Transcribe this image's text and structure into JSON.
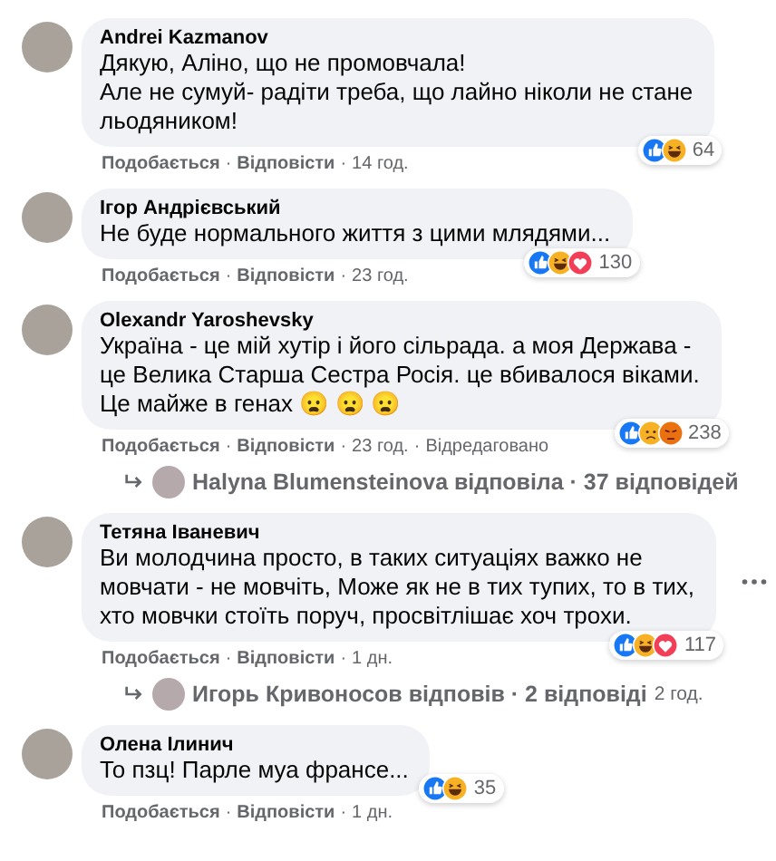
{
  "comments": [
    {
      "author": "Andrei Kazmanov",
      "text": "Дякую, Аліно, що не промовчала!\nАле не сумуй- радіти треба, що лайно ніколи не стане\nльодяником!",
      "reactions": [
        {
          "kind": "like"
        },
        {
          "kind": "haha"
        }
      ],
      "reaction_count": "64",
      "actions": [
        {
          "kind": "link",
          "text": "Подобається"
        },
        {
          "kind": "separator",
          "text": "·"
        },
        {
          "kind": "link",
          "text": "Відповісти"
        },
        {
          "kind": "separator",
          "text": "·"
        },
        {
          "kind": "time",
          "text": "14 год."
        }
      ],
      "show_menu": false
    },
    {
      "author": "Ігор Андрієвський",
      "text": "Не буде нормального життя з цими млядями...",
      "reactions": [
        {
          "kind": "like"
        },
        {
          "kind": "haha"
        },
        {
          "kind": "love"
        }
      ],
      "reaction_count": "130",
      "actions": [
        {
          "kind": "link",
          "text": "Подобається"
        },
        {
          "kind": "separator",
          "text": "·"
        },
        {
          "kind": "link",
          "text": "Відповісти"
        },
        {
          "kind": "separator",
          "text": "·"
        },
        {
          "kind": "time",
          "text": "23 год."
        }
      ],
      "show_menu": false
    },
    {
      "author": "Olexandr Yaroshevsky",
      "text": "Україна - це мій хутір і його сільрада. а моя Держава -\nце Велика Старша Сестра Росія. це вбивалося віками.\nЦе майже в генах 😦 😦 😦",
      "reactions": [
        {
          "kind": "like"
        },
        {
          "kind": "sad"
        },
        {
          "kind": "angry"
        }
      ],
      "reaction_count": "238",
      "actions": [
        {
          "kind": "link",
          "text": "Подобається"
        },
        {
          "kind": "separator",
          "text": "·"
        },
        {
          "kind": "link",
          "text": "Відповісти"
        },
        {
          "kind": "separator",
          "text": "·"
        },
        {
          "kind": "time",
          "text": "23 год."
        },
        {
          "kind": "separator",
          "text": "·"
        },
        {
          "kind": "time",
          "text": "Відредаговано"
        }
      ],
      "show_menu": false,
      "replies": {
        "text": "Halyna Blumensteinova відповіла · 37 відповідей"
      }
    },
    {
      "author": "Тетяна Іваневич",
      "text": "Ви молодчина просто, в таких ситуаціях важко не\nмовчати - не мовчіть, Може як не в тих тупих, то в тих,\nхто мовчки стоїть поруч, просвітлішає хоч трохи.",
      "reactions": [
        {
          "kind": "like"
        },
        {
          "kind": "haha"
        },
        {
          "kind": "love"
        }
      ],
      "reaction_count": "117",
      "actions": [
        {
          "kind": "link",
          "text": "Подобається"
        },
        {
          "kind": "separator",
          "text": "·"
        },
        {
          "kind": "link",
          "text": "Відповісти"
        },
        {
          "kind": "separator",
          "text": "·"
        },
        {
          "kind": "time",
          "text": "1 дн."
        }
      ],
      "show_menu": true,
      "replies": {
        "text": "Игорь Кривоносов відповів · 2 відповіді",
        "time": "2 год."
      }
    },
    {
      "author": "Олена Ілинич",
      "text": "То пзц! Парле муа франсе...",
      "reactions": [
        {
          "kind": "like"
        },
        {
          "kind": "haha"
        }
      ],
      "reaction_count": "35",
      "actions": [
        {
          "kind": "link",
          "text": "Подобається"
        },
        {
          "kind": "separator",
          "text": "·"
        },
        {
          "kind": "link",
          "text": "Відповісти"
        },
        {
          "kind": "separator",
          "text": "·"
        },
        {
          "kind": "time",
          "text": "1 дн."
        }
      ],
      "show_menu": false
    }
  ]
}
